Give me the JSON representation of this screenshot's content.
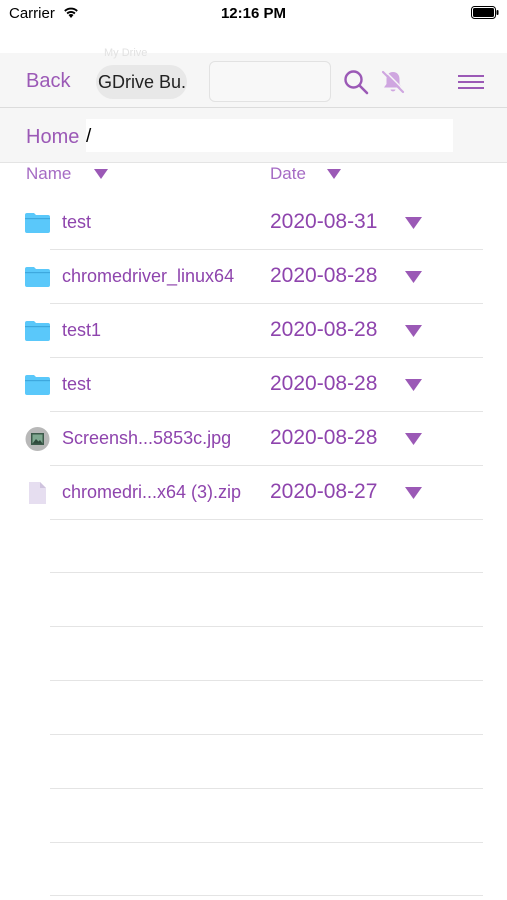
{
  "status_bar": {
    "carrier": "Carrier",
    "time": "12:16 PM",
    "icons": [
      "wifi-icon",
      "battery-icon"
    ]
  },
  "toolbar": {
    "back_label": "Back",
    "drive_label": "GDrive Bu..",
    "ghost_label": "My Drive",
    "search_value": "",
    "icons": [
      "search-icon",
      "bell-off-icon",
      "menu-icon"
    ]
  },
  "breadcrumb": {
    "home_label": "Home",
    "separator": "/"
  },
  "columns": {
    "name_label": "Name",
    "date_label": "Date"
  },
  "files": [
    {
      "name": "test",
      "date": "2020-08-31",
      "icon": "folder-icon"
    },
    {
      "name": "chromedriver_linux64",
      "date": "2020-08-28",
      "icon": "folder-icon"
    },
    {
      "name": "test1",
      "date": "2020-08-28",
      "icon": "folder-icon"
    },
    {
      "name": "test",
      "date": "2020-08-28",
      "icon": "folder-icon"
    },
    {
      "name": "Screensh...5853c.jpg",
      "date": "2020-08-28",
      "icon": "image-file-icon"
    },
    {
      "name": "chromedri...x64 (3).zip",
      "date": "2020-08-27",
      "icon": "document-file-icon"
    }
  ],
  "colors": {
    "accent": "#9b59b6",
    "folder": "#5ac8fa"
  }
}
